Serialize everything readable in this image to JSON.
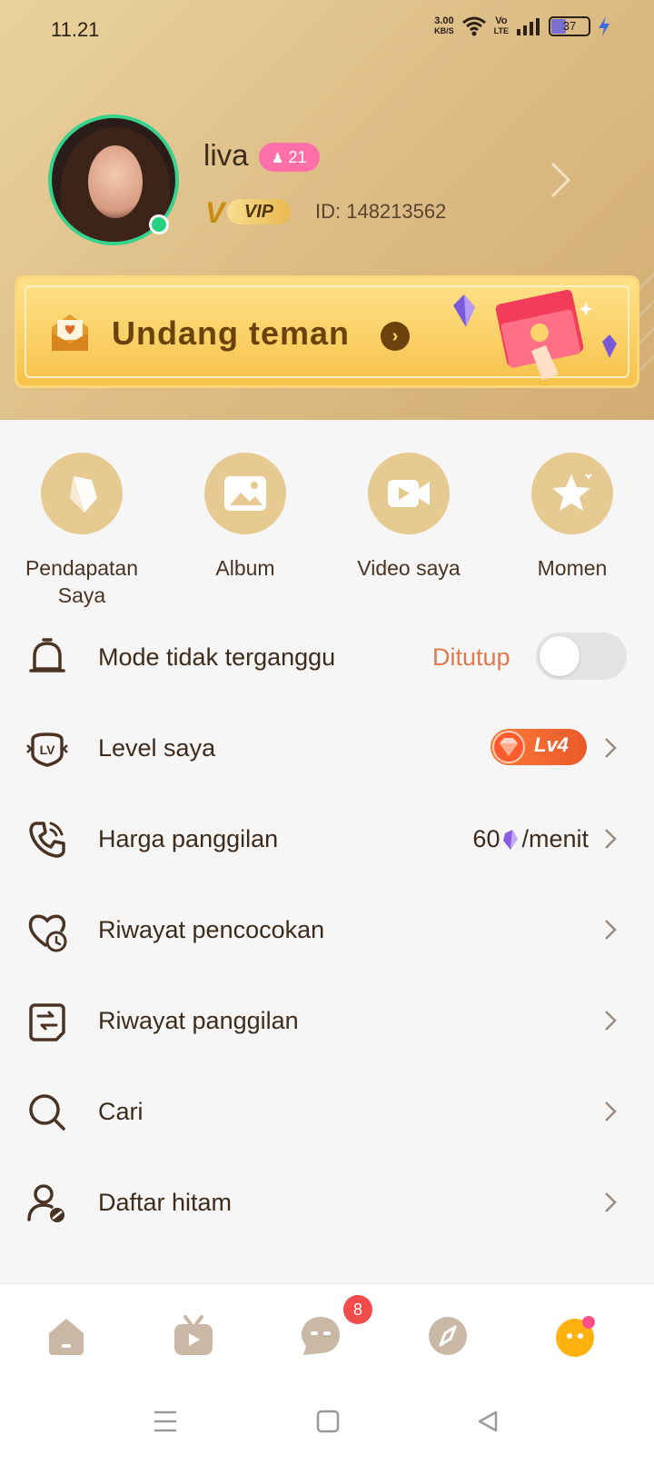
{
  "status_bar": {
    "time": "11.21",
    "net_speed_top": "3.00",
    "net_speed_unit": "KB/S",
    "volte_top": "Vo",
    "volte_bottom": "LTE",
    "battery": "37"
  },
  "profile": {
    "username": "liva",
    "age": "21",
    "vip_label": "VIP",
    "vip_letter": "V",
    "id_text": "ID: 148213562"
  },
  "invite": {
    "label": "Undang teman"
  },
  "quick_actions": [
    {
      "label_line1": "Pendapatan",
      "label_line2": "Saya",
      "icon": "diamond-icon"
    },
    {
      "label_line1": "Album",
      "label_line2": "",
      "icon": "image-icon"
    },
    {
      "label_line1": "Video saya",
      "label_line2": "",
      "icon": "video-icon"
    },
    {
      "label_line1": "Momen",
      "label_line2": "",
      "icon": "star-icon"
    }
  ],
  "menu": {
    "dnd_label": "Mode tidak terganggu",
    "dnd_status": "Ditutup",
    "level_label": "Level saya",
    "level_value": "Lv4",
    "call_price_label": "Harga panggilan",
    "call_price_value": "60",
    "call_price_unit": "/menit",
    "match_history_label": "Riwayat pencocokan",
    "call_history_label": "Riwayat panggilan",
    "search_label": "Cari",
    "blacklist_label": "Daftar hitam"
  },
  "bottom_nav": {
    "message_badge": "8"
  },
  "colors": {
    "accent": "#e07a4d",
    "header_gold": "#dcbb84",
    "icon_circle": "#e7c992",
    "online": "#27d27f"
  }
}
